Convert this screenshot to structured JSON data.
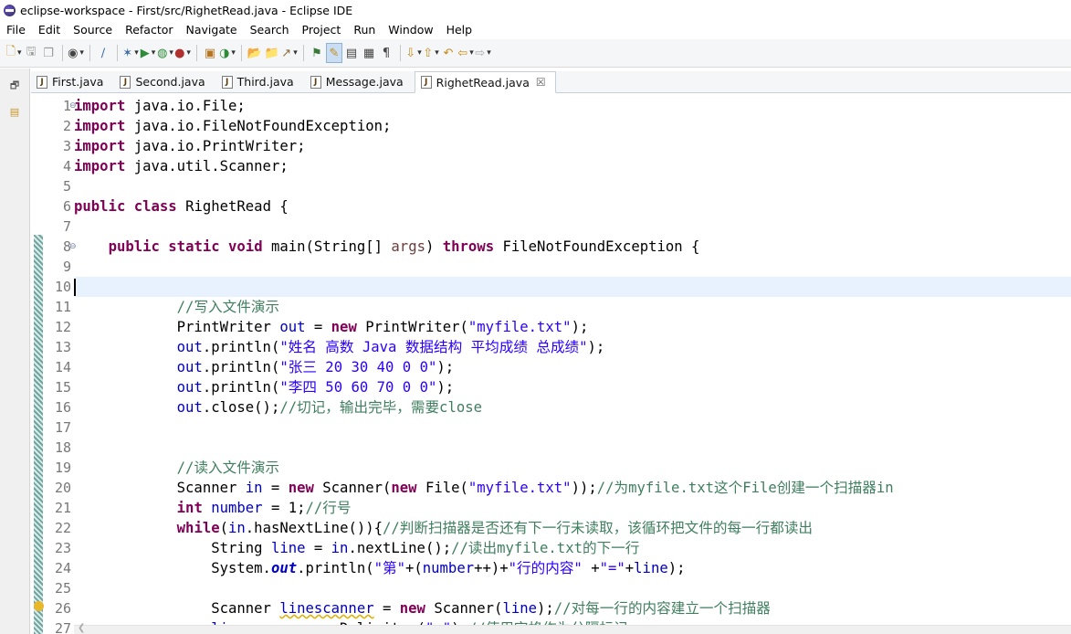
{
  "window": {
    "title": "eclipse-workspace - First/src/RighetRead.java - Eclipse IDE"
  },
  "menu": [
    "File",
    "Edit",
    "Source",
    "Refactor",
    "Navigate",
    "Search",
    "Project",
    "Run",
    "Window",
    "Help"
  ],
  "tabs": [
    {
      "label": "First.java",
      "active": false
    },
    {
      "label": "Second.java",
      "active": false
    },
    {
      "label": "Third.java",
      "active": false
    },
    {
      "label": "Message.java",
      "active": false
    },
    {
      "label": "RighetRead.java",
      "active": true
    }
  ],
  "editor": {
    "current_line": 10,
    "line_numbers": [
      "1",
      "2",
      "3",
      "4",
      "5",
      "6",
      "7",
      "8",
      "9",
      "10",
      "11",
      "12",
      "13",
      "14",
      "15",
      "16",
      "17",
      "18",
      "19",
      "20",
      "21",
      "22",
      "23",
      "24",
      "25",
      "26",
      "27"
    ],
    "lines": [
      "import java.io.File;",
      "import java.io.FileNotFoundException;",
      "import java.io.PrintWriter;",
      "import java.util.Scanner;",
      "",
      "public class RighetRead {",
      "",
      "    public static void main(String[] args) throws FileNotFoundException {",
      "",
      "",
      "            //写入文件演示",
      "            PrintWriter out = new PrintWriter(\"myfile.txt\");",
      "            out.println(\"姓名 高数 Java 数据结构 平均成绩 总成绩\");",
      "            out.println(\"张三 20 30 40 0 0\");",
      "            out.println(\"李四 50 60 70 0 0\");",
      "            out.close();//切记，输出完毕，需要close",
      "",
      "",
      "            //读入文件演示",
      "            Scanner in = new Scanner(new File(\"myfile.txt\"));//为myfile.txt这个File创建一个扫描器in",
      "            int number = 1;//行号",
      "            while(in.hasNextLine()){//判断扫描器是否还有下一行未读取，该循环把文件的每一行都读出",
      "                String line = in.nextLine();//读出myfile.txt的下一行",
      "                System.out.println(\"第\"+(number++)+\"行的内容\" +\"=\"+line);",
      "",
      "                Scanner linescanner = new Scanner(line);//对每一行的内容建立一个扫描器",
      "                linescanner.useDelimiter(\" \");//使用空格作为分隔标记"
    ]
  },
  "colors": {
    "keyword": "#7f0055",
    "string": "#2a00ff",
    "comment": "#3f7f5f",
    "field": "#0000c0",
    "current_line": "#e8f2fe"
  }
}
